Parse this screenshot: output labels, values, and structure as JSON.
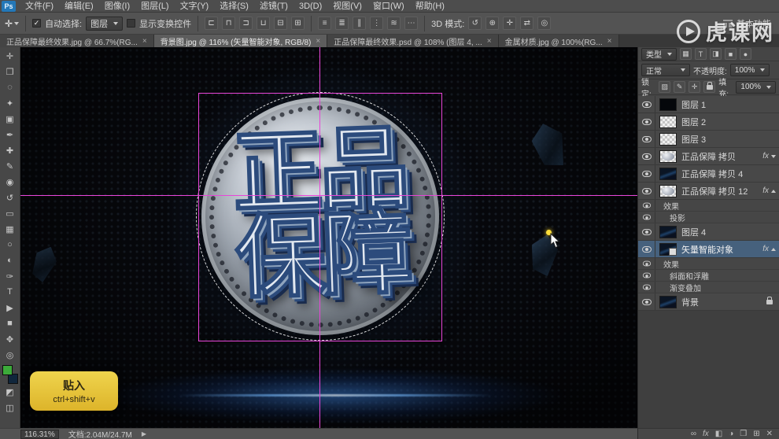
{
  "menu": {
    "logo": "Ps",
    "items": [
      "文件(F)",
      "编辑(E)",
      "图像(I)",
      "图层(L)",
      "文字(Y)",
      "选择(S)",
      "滤镜(T)",
      "3D(D)",
      "视图(V)",
      "窗口(W)",
      "帮助(H)"
    ]
  },
  "options": {
    "tool_icon": "✛",
    "auto_select_label": "自动选择:",
    "auto_select_value": "图层",
    "show_transform_label": "显示变换控件",
    "align_icons": [
      "⊏",
      "⊓",
      "⊐",
      "⊔",
      "⊟",
      "⊞"
    ],
    "distribute_icons": [
      "≡",
      "≣",
      "∥",
      "⋮",
      "≋",
      "⋯"
    ],
    "mode3d_label": "3D 模式:",
    "mode3d_icons": [
      "↺",
      "⊕",
      "✛",
      "⇄",
      "◎"
    ],
    "workspace_label": "基本功能"
  },
  "tabs": {
    "items": [
      {
        "label": "正品保障最终效果.jpg @ 66.7%(RG..."
      },
      {
        "label": "背景图.jpg @ 116% (矢量智能对象, RGB/8)"
      },
      {
        "label": "正品保障最终效果.psd @ 108% (图层 4, ..."
      },
      {
        "label": "金属材质.jpg @ 100%(RG..."
      }
    ]
  },
  "ui": {
    "close_glyph": "×"
  },
  "watermark": {
    "text": "虎课网"
  },
  "toolbar": {
    "tools": [
      {
        "name": "move",
        "glyph": "✛"
      },
      {
        "name": "rectangular-marquee",
        "glyph": "❒"
      },
      {
        "name": "lasso",
        "glyph": "◌"
      },
      {
        "name": "quick-selection",
        "glyph": "✦"
      },
      {
        "name": "crop",
        "glyph": "▣"
      },
      {
        "name": "eyedropper",
        "glyph": "✒"
      },
      {
        "name": "spot-healing",
        "glyph": "✚"
      },
      {
        "name": "brush",
        "glyph": "✎"
      },
      {
        "name": "clone-stamp",
        "glyph": "◉"
      },
      {
        "name": "history-brush",
        "glyph": "↺"
      },
      {
        "name": "eraser",
        "glyph": "▭"
      },
      {
        "name": "gradient",
        "glyph": "▦"
      },
      {
        "name": "blur",
        "glyph": "○"
      },
      {
        "name": "dodge",
        "glyph": "◐"
      },
      {
        "name": "pen",
        "glyph": "✑"
      },
      {
        "name": "type",
        "glyph": "T"
      },
      {
        "name": "path-selection",
        "glyph": "▶"
      },
      {
        "name": "shape",
        "glyph": "■"
      },
      {
        "name": "hand",
        "glyph": "✥"
      },
      {
        "name": "zoom",
        "glyph": "◎"
      }
    ]
  },
  "canvas": {
    "art_line1": "正品",
    "art_line2": "保障",
    "tooltip_title": "贴入",
    "tooltip_shortcut": "ctrl+shift+v"
  },
  "layers": {
    "filter_kind_label": "类型",
    "filter_icons": [
      "▦",
      "T",
      "◨",
      "■",
      "●"
    ],
    "blend_mode": "正常",
    "opacity_label": "不透明度:",
    "opacity_value": "100%",
    "lock_label": "锁定:",
    "lock_icons": [
      "▨",
      "✎",
      "✛"
    ],
    "fill_label": "填充:",
    "fill_value": "100%",
    "fx_label": "fx",
    "rows": [
      {
        "name": "图层 1"
      },
      {
        "name": "图层 2"
      },
      {
        "name": "图层 3"
      },
      {
        "name": "正品保障 拷贝"
      },
      {
        "name": "正品保障 拷贝 4"
      },
      {
        "name": "正品保障 拷贝 12"
      },
      {
        "name": "效果"
      },
      {
        "name": "投影"
      },
      {
        "name": "图层 4"
      },
      {
        "name": "矢量智能对象"
      },
      {
        "name": "效果"
      },
      {
        "name": "斜面和浮雕"
      },
      {
        "name": "渐变叠加"
      },
      {
        "name": "背景"
      }
    ],
    "footer_icons": [
      "∞",
      "fx",
      "◧",
      "◑",
      "❒",
      "⊞",
      "✕"
    ]
  },
  "status": {
    "zoom": "116.31%",
    "doc": "文档:2.04M/24.7M",
    "play_glyph": "▶"
  },
  "colors": {
    "guide_magenta": "#e845d8",
    "tooltip_yellow": "#e8c437",
    "selected_layer": "#46617d",
    "flare_blue": "#3f8cff",
    "cursor_dot_yellow": "#ffdf3a"
  }
}
